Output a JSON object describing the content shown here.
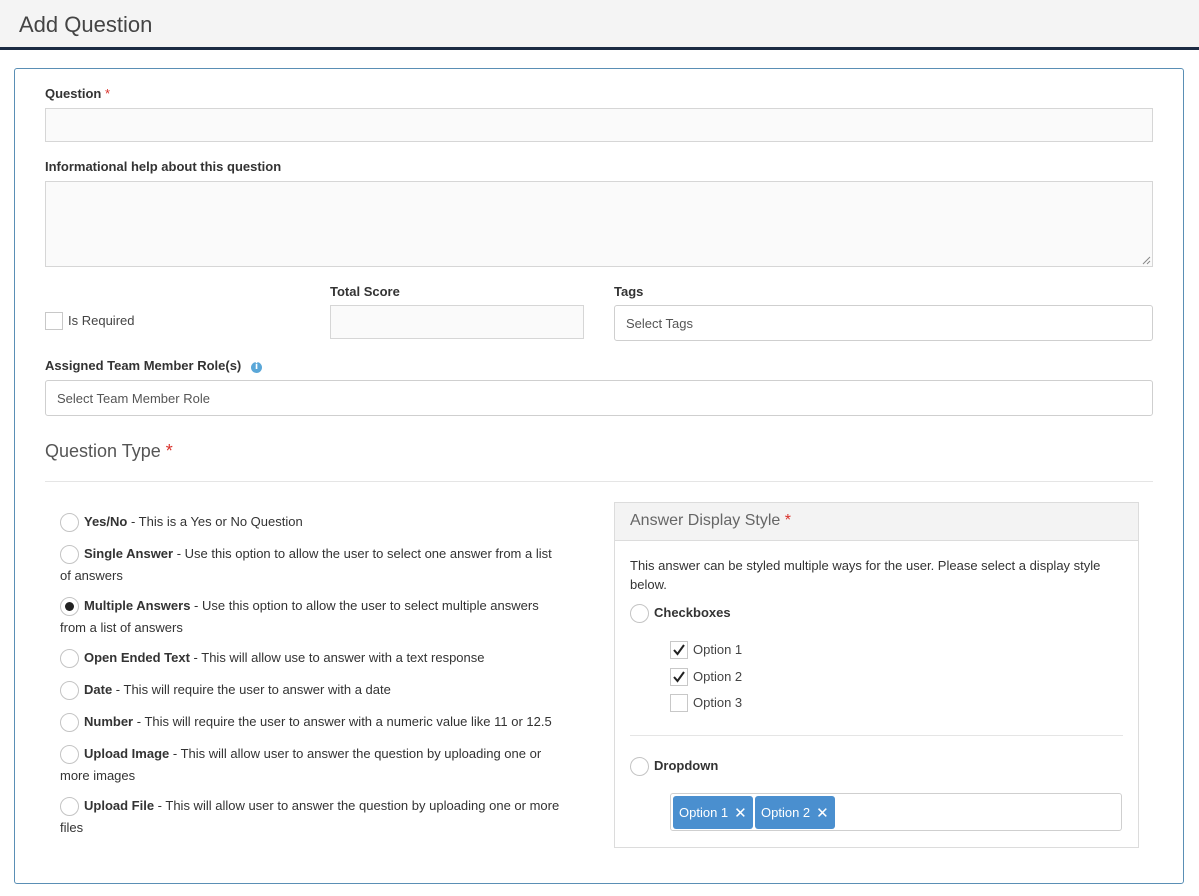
{
  "header": {
    "title": "Add Question"
  },
  "form": {
    "question_label": "Question",
    "required_mark": "*",
    "question_value": "",
    "help_label": "Informational help about this question",
    "help_value": "",
    "is_required_label": "Is Required",
    "total_score_label": "Total Score",
    "total_score_value": "",
    "tags_label": "Tags",
    "tags_placeholder": "Select Tags",
    "roles_label": "Assigned Team Member Role(s)",
    "roles_placeholder": "Select Team Member Role",
    "info_icon": "i"
  },
  "question_type": {
    "title": "Question Type",
    "selected": "Multiple Answers",
    "options": [
      {
        "name": "Yes/No",
        "desc": " - This is a Yes or No Question",
        "desc2": ""
      },
      {
        "name": "Single Answer",
        "desc": " - Use this option to allow the user to select one answer from a list",
        "desc2": "of answers"
      },
      {
        "name": "Multiple Answers",
        "desc": " - Use this option to allow the user to select multiple answers",
        "desc2": "from a list of answers"
      },
      {
        "name": "Open Ended Text",
        "desc": " - This will allow use to answer with a text response",
        "desc2": ""
      },
      {
        "name": "Date",
        "desc": " - This will require the user to answer with a date",
        "desc2": ""
      },
      {
        "name": "Number",
        "desc": " - This will require the user to answer with a numeric value like 11 or 12.5",
        "desc2": ""
      },
      {
        "name": "Upload Image",
        "desc": " - This will allow user to answer the question by uploading one or",
        "desc2": "more images"
      },
      {
        "name": "Upload File",
        "desc": " - This will allow user to answer the question by uploading one or more",
        "desc2": "files"
      }
    ]
  },
  "display_style": {
    "title": "Answer Display Style",
    "description_line1": "This answer can be styled multiple ways for the user. Please select a display style",
    "description_line2": "below.",
    "checkboxes_label": "Checkboxes",
    "checkbox_options": [
      {
        "label": "Option 1",
        "checked": true
      },
      {
        "label": "Option 2",
        "checked": true
      },
      {
        "label": "Option 3",
        "checked": false
      }
    ],
    "dropdown_label": "Dropdown",
    "dropdown_tags": [
      "Option 1",
      "Option 2"
    ]
  },
  "colors": {
    "header_border": "#1c2b43",
    "card_border": "#5a8fb5",
    "required": "#d9302a",
    "tag_bg": "#4a8fcf",
    "info_icon": "#5aa7d8"
  }
}
